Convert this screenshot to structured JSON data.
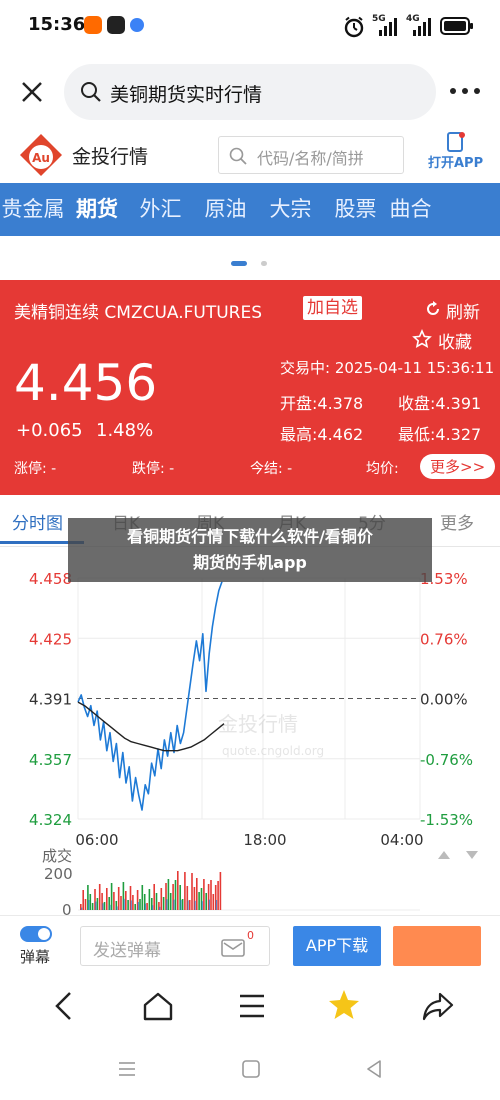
{
  "status_bar": {
    "time": "15:36",
    "network_1": "5G",
    "network_2": "4G"
  },
  "browser": {
    "search_text": "美铜期货实时行情"
  },
  "site": {
    "brand": "金投行情",
    "search_placeholder": "代码/名称/简拼",
    "open_app": "打开APP"
  },
  "categories": [
    "贵金属",
    "期货",
    "外汇",
    "原油",
    "大宗",
    "股票",
    "曲合"
  ],
  "quote": {
    "name": "美精铜连续 CMZCUA.FUTURES",
    "add_watch": "加自选",
    "refresh": "刷新",
    "favorite": "收藏",
    "price": "4.456",
    "change": "+0.065",
    "change_pct": "1.48%",
    "trade_time": "交易中: 2025-04-11 15:36:11",
    "open": "开盘:4.378",
    "prev_close": "收盘:4.391",
    "high": "最高:4.462",
    "low": "最低:4.327",
    "limit_up": "涨停: -",
    "limit_down": "跌停: -",
    "settle": "今结: -",
    "avg": "均价:",
    "more": "更多>>"
  },
  "chart_tabs": [
    "分时图",
    "日K",
    "周K",
    "月K",
    "5分",
    "更多"
  ],
  "overlay": {
    "line1": "看铜期货行情下载什么软件/看铜价",
    "line2": "期货的手机app"
  },
  "chart_data": {
    "type": "line",
    "title": "",
    "x_ticks": [
      "06:00",
      "18:00",
      "04:00"
    ],
    "y_left_ticks": [
      "4.458",
      "4.425",
      "4.391",
      "4.357",
      "4.324"
    ],
    "y_right_ticks": [
      "1.53%",
      "0.76%",
      "0.00%",
      "-0.76%",
      "-1.53%"
    ],
    "ylim": [
      4.324,
      4.458
    ],
    "prev_close": 4.391,
    "series": [
      {
        "values": [
          4.389,
          4.393,
          4.386,
          4.381,
          4.387,
          4.376,
          4.384,
          4.368,
          4.378,
          4.362,
          4.372,
          4.356,
          4.366,
          4.347,
          4.361,
          4.344,
          4.353,
          4.334,
          4.347,
          4.337,
          4.329,
          4.343,
          4.338,
          4.355,
          4.348,
          4.363,
          4.352,
          4.368,
          4.359,
          4.372,
          4.361,
          4.376,
          4.366,
          4.372,
          4.385,
          4.398,
          4.411,
          4.423,
          4.412,
          4.427,
          4.395,
          4.416,
          4.431,
          4.442,
          4.451,
          4.456
        ],
        "color": "#1e7ad6"
      },
      {
        "values": [
          4.389,
          4.387,
          4.384,
          4.381,
          4.378,
          4.375,
          4.372,
          4.369,
          4.367,
          4.366,
          4.365,
          4.364,
          4.363,
          4.362,
          4.362,
          4.362,
          4.363,
          4.364,
          4.366,
          4.368,
          4.371,
          4.374,
          4.377
        ],
        "color": "#222222"
      }
    ],
    "volume_label": "成交",
    "volume_ticks": [
      "200",
      "0"
    ],
    "watermark": "金投行情",
    "watermark_url": "quote.cngold.org"
  },
  "comment_bar": {
    "toggle_label": "弹幕",
    "input_placeholder": "发送弹幕",
    "badge": "0",
    "app_download": "APP下载"
  },
  "colors": {
    "up_red": "#e53935",
    "down_green": "#1f9d3f",
    "accent_blue": "#3a7ed0",
    "chart_line": "#1e7ad6",
    "orange": "#ff8a50"
  }
}
